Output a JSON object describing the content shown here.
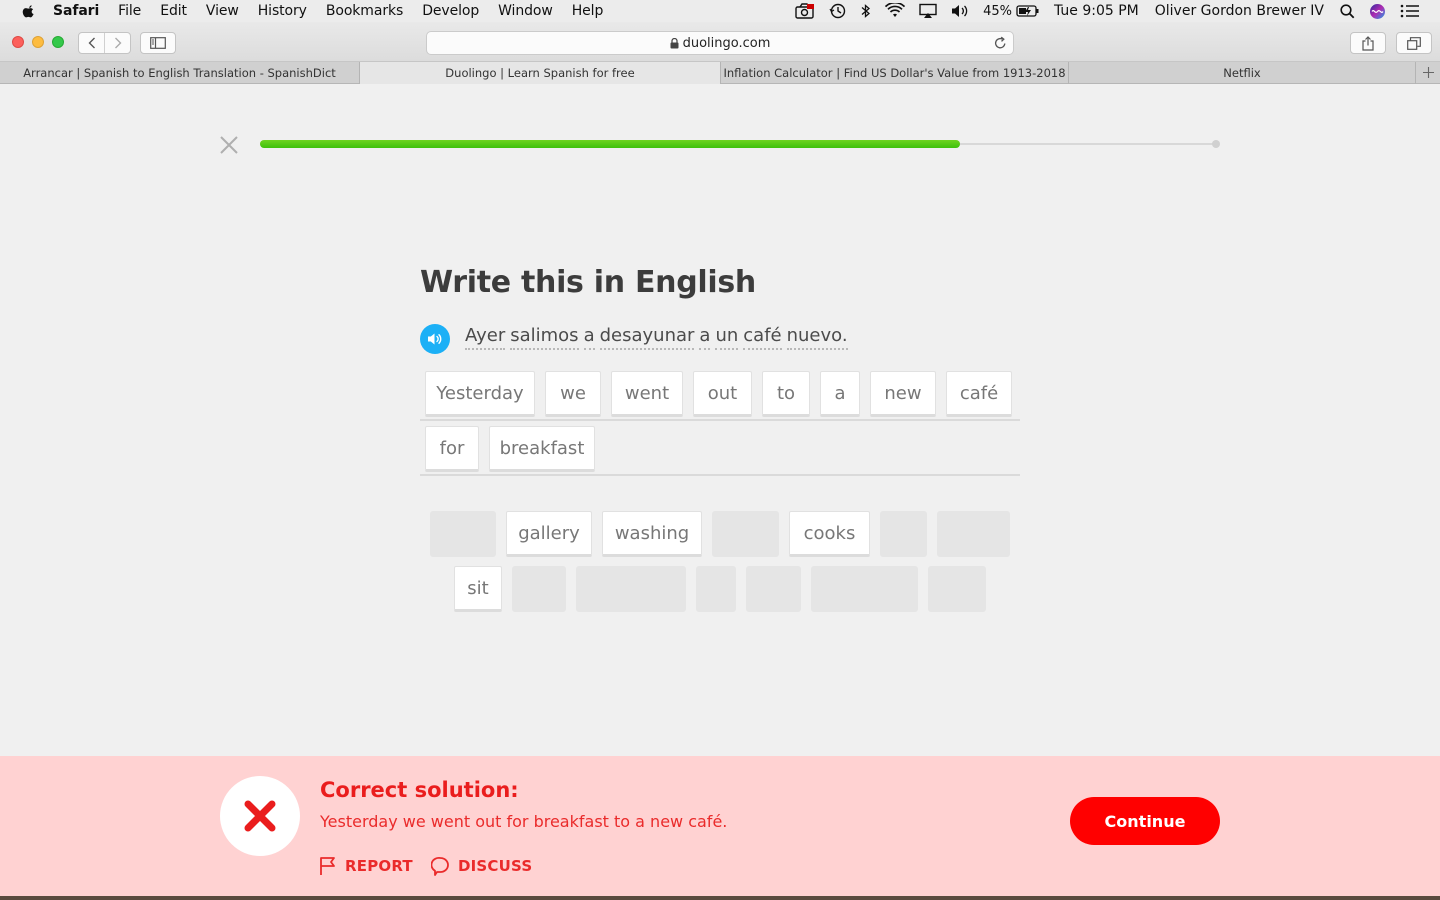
{
  "menubar": {
    "app_name": "Safari",
    "items": [
      "File",
      "Edit",
      "View",
      "History",
      "Bookmarks",
      "Develop",
      "Window",
      "Help"
    ],
    "battery": "45%",
    "clock": "Tue 9:05 PM",
    "user": "Oliver Gordon Brewer IV",
    "status_icons": [
      "photo-booth-icon",
      "time-machine-icon",
      "bluetooth-icon",
      "wifi-icon",
      "airplay-icon",
      "volume-icon",
      "battery-icon",
      "spotlight-icon",
      "siri-icon",
      "notification-center-icon"
    ]
  },
  "browser": {
    "url": "duolingo.com",
    "tabs": [
      {
        "label": "Arrancar | Spanish to English Translation - SpanishDict",
        "active": false
      },
      {
        "label": "Duolingo | Learn Spanish for free",
        "active": true
      },
      {
        "label": "Inflation Calculator | Find US Dollar's Value from 1913-2018",
        "active": false
      },
      {
        "label": "Netflix",
        "active": false
      }
    ]
  },
  "lesson": {
    "progress_fraction": 0.732,
    "prompt_title": "Write this in English",
    "source_words": [
      "Ayer",
      "salimos",
      "a",
      "desayunar",
      "a",
      "un",
      "café",
      "nuevo."
    ],
    "answer_rows": [
      [
        "Yesterday",
        "we",
        "went",
        "out",
        "to",
        "a",
        "new",
        "café"
      ],
      [
        "for",
        "breakfast"
      ]
    ],
    "bank_row_1": [
      "gallery",
      "washing",
      "cooks"
    ],
    "bank_row_2": [
      "sit"
    ]
  },
  "feedback": {
    "title": "Correct solution:",
    "solution": "Yesterday we went out for breakfast to a new café.",
    "report_label": "REPORT",
    "discuss_label": "DISCUSS",
    "continue_label": "Continue",
    "colors": {
      "background": "#ffd2d2",
      "accent": "#ea2b2b",
      "button": "#ff0000"
    }
  },
  "colors": {
    "progress": "#58cc02",
    "speaker": "#1cb0f6"
  }
}
